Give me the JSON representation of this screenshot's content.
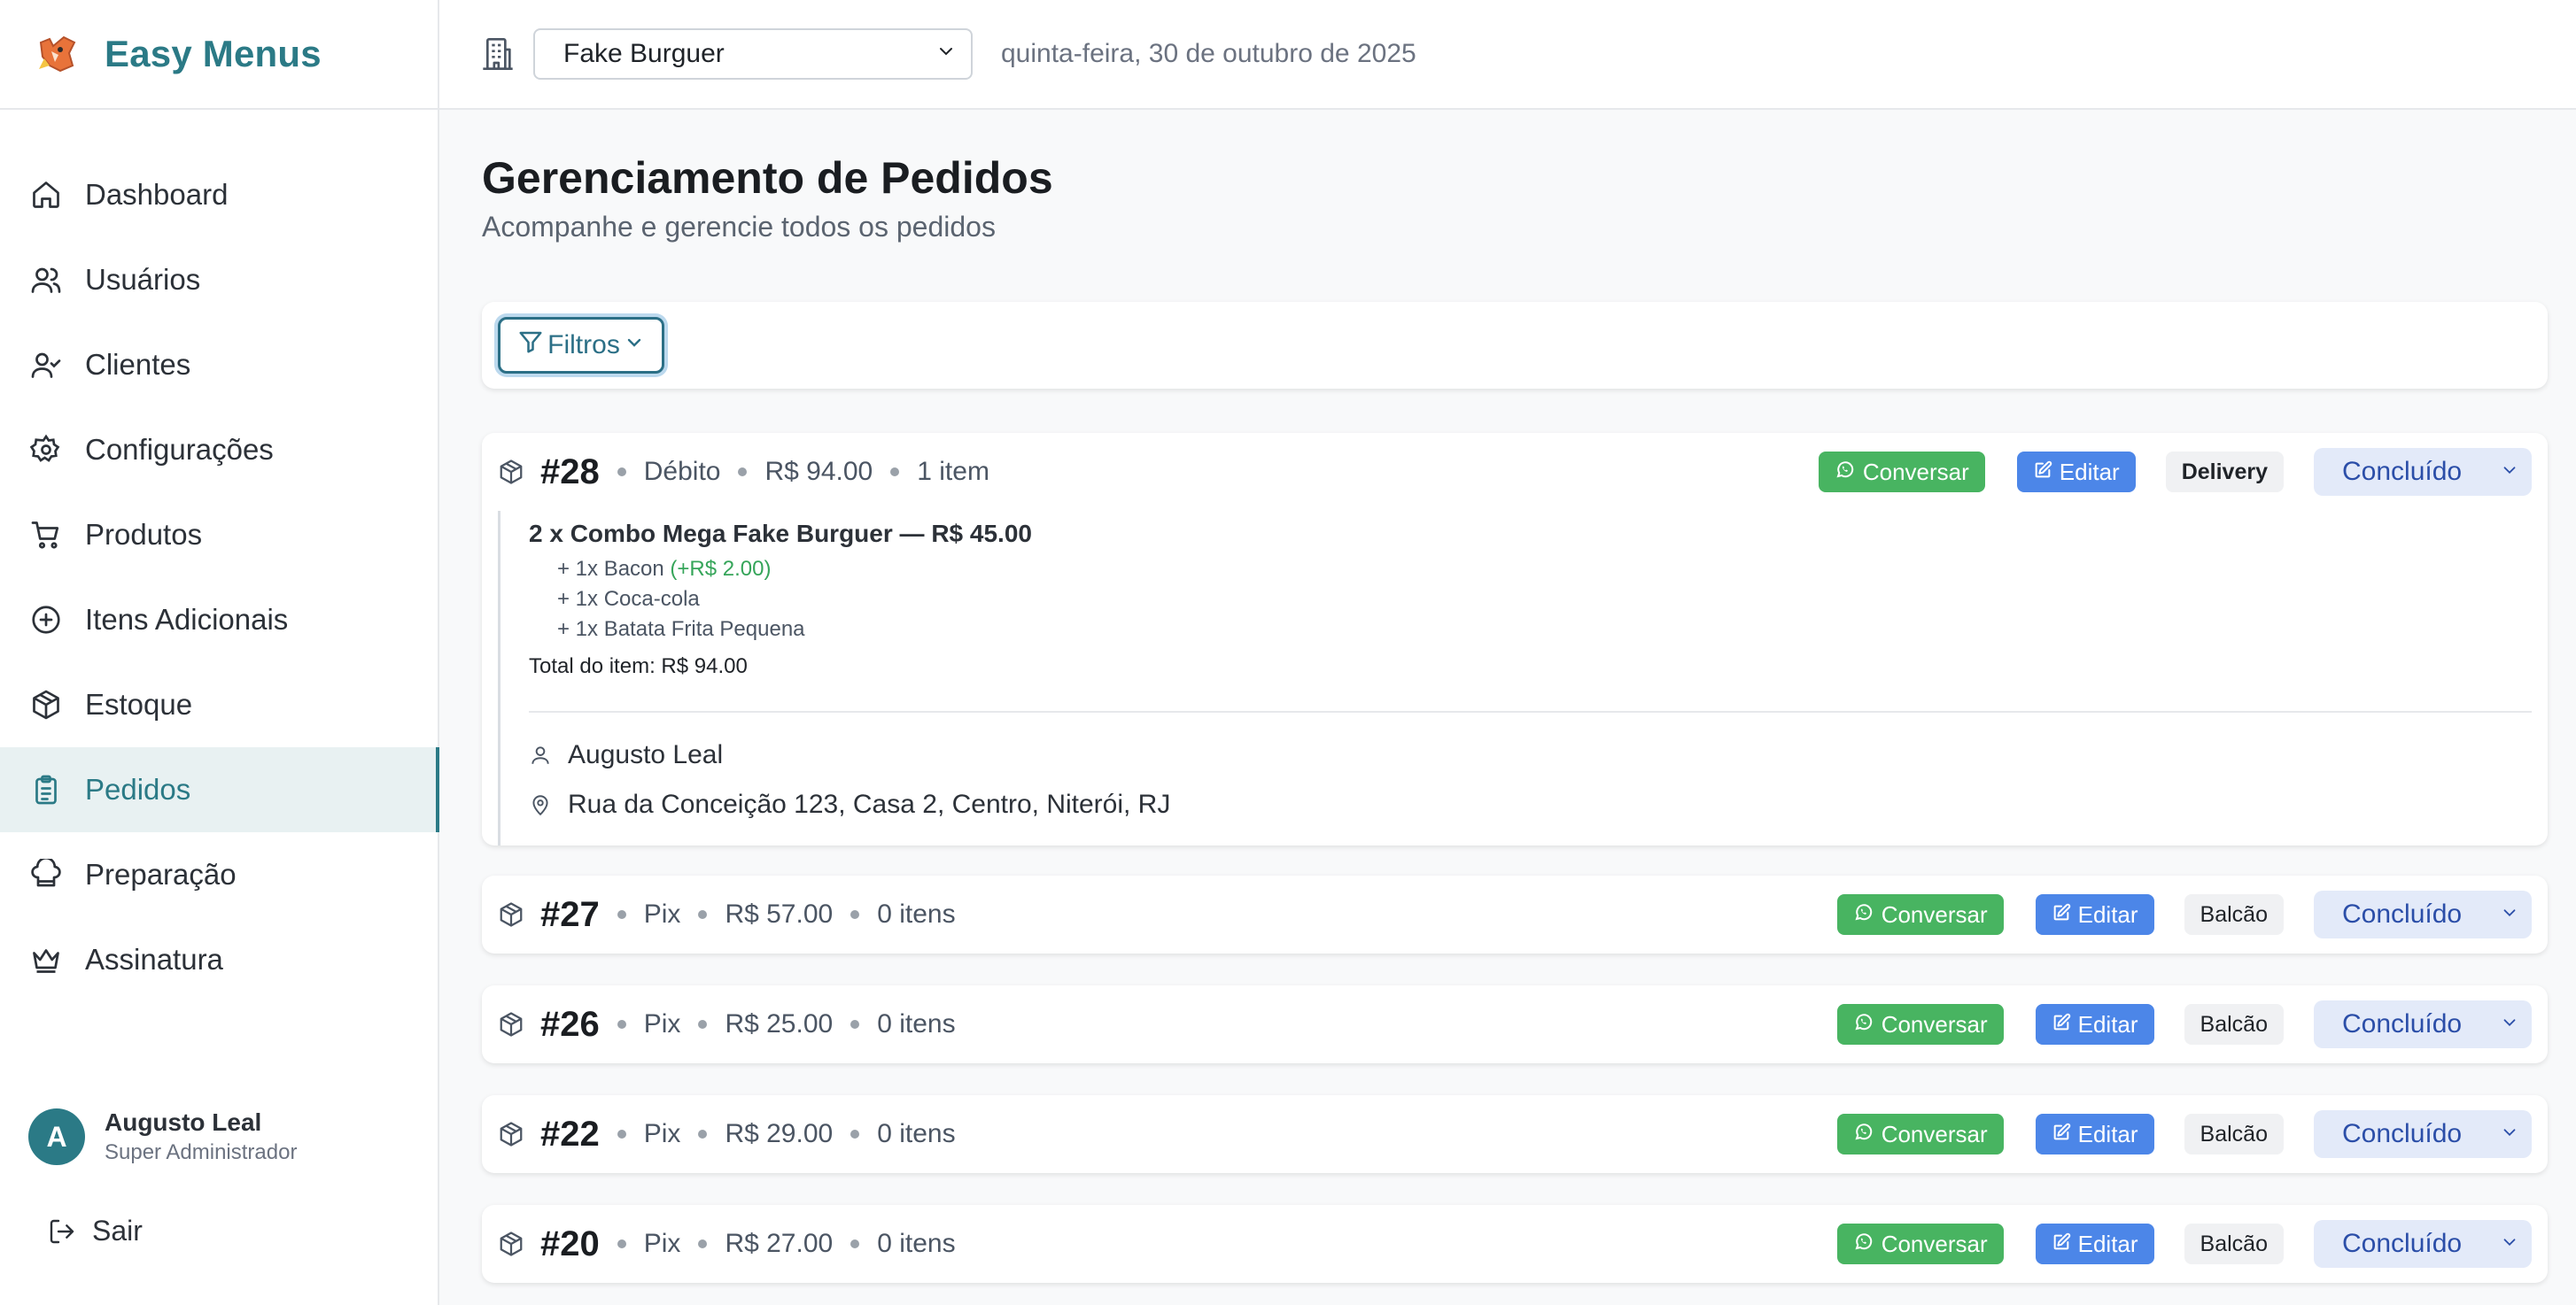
{
  "app": {
    "brand": "Easy Menus"
  },
  "sidebar": {
    "items": [
      {
        "label": "Dashboard",
        "icon": "home-icon"
      },
      {
        "label": "Usuários",
        "icon": "users-icon"
      },
      {
        "label": "Clientes",
        "icon": "user-check-icon"
      },
      {
        "label": "Configurações",
        "icon": "gear-icon"
      },
      {
        "label": "Produtos",
        "icon": "cart-icon"
      },
      {
        "label": "Itens Adicionais",
        "icon": "plus-circle-icon"
      },
      {
        "label": "Estoque",
        "icon": "package-icon"
      },
      {
        "label": "Pedidos",
        "icon": "clipboard-icon",
        "active": true
      },
      {
        "label": "Preparação",
        "icon": "chef-hat-icon"
      },
      {
        "label": "Assinatura",
        "icon": "crown-icon"
      }
    ],
    "user": {
      "initial": "A",
      "name": "Augusto Leal",
      "role": "Super Administrador"
    },
    "logout_label": "Sair"
  },
  "topbar": {
    "store": "Fake Burguer",
    "date": "quinta-feira, 30 de outubro de 2025"
  },
  "page": {
    "title": "Gerenciamento de Pedidos",
    "subtitle": "Acompanhe e gerencie todos os pedidos",
    "filter_label": "Filtros"
  },
  "actions": {
    "chat_label": "Conversar",
    "edit_label": "Editar"
  },
  "orders": [
    {
      "id": "#28",
      "payment": "Débito",
      "total": "R$ 94.00",
      "items_count": "1 item",
      "type": "Delivery",
      "status": "Concluído",
      "details": {
        "item_title": "2 x Combo Mega Fake Burguer — R$ 45.00",
        "addons": [
          {
            "text": "+ 1x Bacon",
            "price": "(+R$ 2.00)"
          },
          {
            "text": "+ 1x Coca-cola",
            "price": ""
          },
          {
            "text": "+ 1x Batata Frita Pequena",
            "price": ""
          }
        ],
        "item_total": "Total do item: R$ 94.00",
        "customer": "Augusto Leal",
        "address": "Rua da Conceição 123, Casa 2, Centro, Niterói, RJ"
      }
    },
    {
      "id": "#27",
      "payment": "Pix",
      "total": "R$ 57.00",
      "items_count": "0 itens",
      "type": "Balcão",
      "status": "Concluído"
    },
    {
      "id": "#26",
      "payment": "Pix",
      "total": "R$ 25.00",
      "items_count": "0 itens",
      "type": "Balcão",
      "status": "Concluído"
    },
    {
      "id": "#22",
      "payment": "Pix",
      "total": "R$ 29.00",
      "items_count": "0 itens",
      "type": "Balcão",
      "status": "Concluído"
    },
    {
      "id": "#20",
      "payment": "Pix",
      "total": "R$ 27.00",
      "items_count": "0 itens",
      "type": "Balcão",
      "status": "Concluído"
    }
  ],
  "colors": {
    "accent": "#2b7a86",
    "chat": "#48b461",
    "edit": "#4c86e8",
    "status_bg": "#e3eaf9",
    "status_text": "#2b4ea8"
  }
}
